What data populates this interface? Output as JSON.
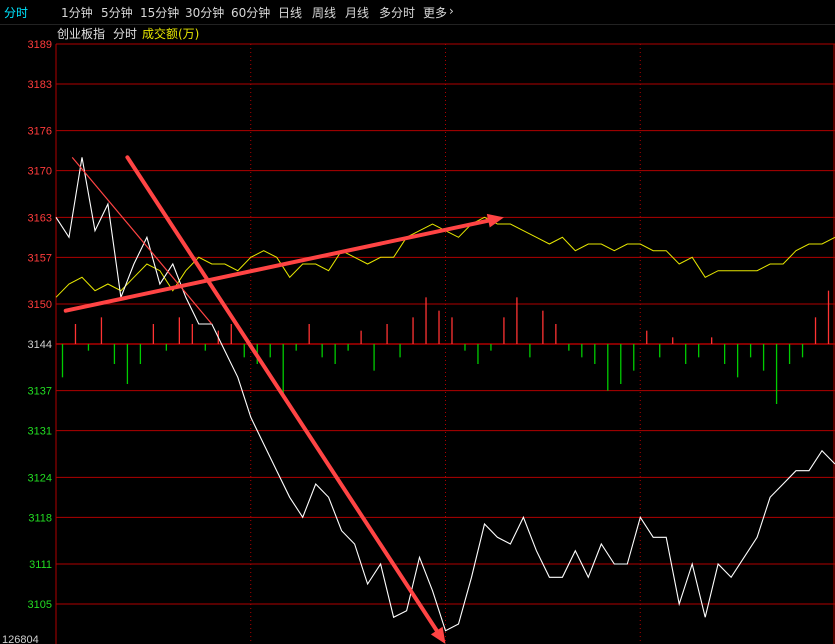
{
  "toolbar": {
    "tabs": [
      "分时",
      "1分钟",
      "5分钟",
      "15分钟",
      "30分钟",
      "60分钟",
      "日线",
      "周线",
      "月线",
      "多分时",
      "更多"
    ],
    "more_arrow": "›"
  },
  "header": {
    "index_name": "创业板指",
    "mode": "分时",
    "volume_label": "成交额(万)"
  },
  "colors": {
    "grid": "#b00000",
    "price_line": "#ffffff",
    "avg_line": "#e6e600",
    "vol_up": "#ff3333",
    "vol_down": "#00cc00",
    "annotation": "#ff4444",
    "active_tab": "#00e5ff",
    "axis_red": "#ff3b3b",
    "axis_green": "#22dd22"
  },
  "chart_data": {
    "type": "line",
    "ylim": [
      3099,
      3189
    ],
    "baseline": 3144,
    "y_ticks": [
      "3189",
      "3183",
      "3176",
      "3170",
      "3163",
      "3157",
      "3150",
      "3144",
      "3137",
      "3131",
      "3124",
      "3118",
      "3111",
      "3105"
    ],
    "bottom_readout": "126804",
    "x_points": 241,
    "series": [
      {
        "role": "price",
        "x": [
          0,
          4,
          8,
          12,
          16,
          20,
          24,
          28,
          32,
          36,
          40,
          44,
          48,
          52,
          56,
          60,
          64,
          68,
          72,
          76,
          80,
          84,
          88,
          92,
          96,
          100,
          104,
          108,
          112,
          116,
          120,
          124,
          128,
          132,
          136,
          140,
          144,
          148,
          152,
          156,
          160,
          164,
          168,
          172,
          176,
          180,
          184,
          188,
          192,
          196,
          200,
          204,
          208,
          212,
          216,
          220,
          224,
          228,
          232,
          236,
          240
        ],
        "values": [
          3163,
          3160,
          3172,
          3161,
          3165,
          3151,
          3156,
          3160,
          3153,
          3156,
          3151,
          3147,
          3147,
          3143,
          3139,
          3133,
          3129,
          3125,
          3121,
          3118,
          3123,
          3121,
          3116,
          3114,
          3108,
          3111,
          3103,
          3104,
          3112,
          3107,
          3101,
          3102,
          3109,
          3117,
          3115,
          3114,
          3118,
          3113,
          3109,
          3109,
          3113,
          3109,
          3114,
          3111,
          3111,
          3118,
          3115,
          3115,
          3105,
          3111,
          3103,
          3111,
          3109,
          3112,
          3115,
          3121,
          3123,
          3125,
          3125,
          3128,
          3126
        ]
      },
      {
        "role": "average",
        "x": [
          0,
          4,
          8,
          12,
          16,
          20,
          24,
          28,
          32,
          36,
          40,
          44,
          48,
          52,
          56,
          60,
          64,
          68,
          72,
          76,
          80,
          84,
          88,
          92,
          96,
          100,
          104,
          108,
          112,
          116,
          120,
          124,
          128,
          132,
          136,
          140,
          144,
          148,
          152,
          156,
          160,
          164,
          168,
          172,
          176,
          180,
          184,
          188,
          192,
          196,
          200,
          204,
          208,
          212,
          216,
          220,
          224,
          228,
          232,
          236,
          240
        ],
        "values": [
          3151,
          3153,
          3154,
          3152,
          3153,
          3152,
          3154,
          3156,
          3155,
          3152,
          3155,
          3157,
          3156,
          3156,
          3155,
          3157,
          3158,
          3157,
          3154,
          3156,
          3156,
          3155,
          3158,
          3157,
          3156,
          3157,
          3157,
          3160,
          3161,
          3162,
          3161,
          3160,
          3162,
          3163,
          3162,
          3162,
          3161,
          3160,
          3159,
          3160,
          3158,
          3159,
          3159,
          3158,
          3159,
          3159,
          3158,
          3158,
          3156,
          3157,
          3154,
          3155,
          3155,
          3155,
          3155,
          3156,
          3156,
          3158,
          3159,
          3159,
          3160
        ]
      }
    ],
    "volume_x": [
      2,
      6,
      10,
      14,
      18,
      22,
      26,
      30,
      34,
      38,
      42,
      46,
      50,
      54,
      58,
      62,
      66,
      70,
      74,
      78,
      82,
      86,
      90,
      94,
      98,
      102,
      106,
      110,
      114,
      118,
      122,
      126,
      130,
      134,
      138,
      142,
      146,
      150,
      154,
      158,
      162,
      166,
      170,
      174,
      178,
      182,
      186,
      190,
      194,
      198,
      202,
      206,
      210,
      214,
      218,
      222,
      226,
      230,
      234,
      238
    ],
    "volume": [
      -5,
      3,
      -1,
      4,
      -3,
      -6,
      -3,
      3,
      -1,
      4,
      3,
      -1,
      2,
      3,
      -2,
      -3,
      -2,
      -8,
      -1,
      3,
      -2,
      -3,
      -1,
      2,
      -4,
      3,
      -2,
      4,
      7,
      5,
      4,
      -1,
      -3,
      -1,
      4,
      7,
      -2,
      5,
      3,
      -1,
      -2,
      -3,
      -7,
      -6,
      -4,
      2,
      -2,
      1,
      -3,
      -2,
      1,
      -3,
      -5,
      -2,
      -4,
      -9,
      -3,
      -2,
      4,
      8
    ]
  },
  "annotations": {
    "arrows": [
      {
        "from": [
          22,
          3172
        ],
        "to": [
          120,
          3099
        ]
      },
      {
        "from": [
          3,
          3149
        ],
        "to": [
          138,
          3163
        ]
      }
    ],
    "trend_line": {
      "from": [
        5,
        3172
      ],
      "to": [
        48,
        3147
      ]
    }
  }
}
